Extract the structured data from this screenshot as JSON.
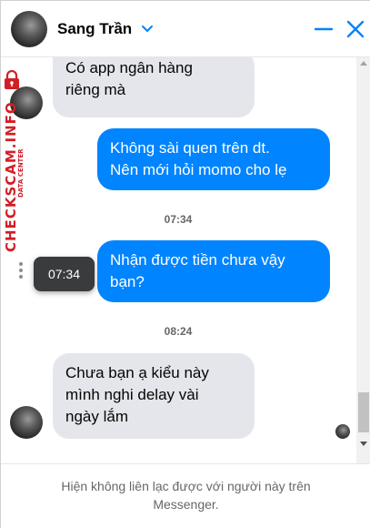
{
  "header": {
    "contact_name": "Sang Trần",
    "icons": {
      "dropdown": "chevron-down-icon",
      "minimize": "minimize-icon",
      "close": "close-icon"
    },
    "accent_color": "#0084ff"
  },
  "messages": [
    {
      "direction": "incoming",
      "lines": [
        "Có app ngân hàng",
        "riêng mà"
      ]
    },
    {
      "direction": "outgoing",
      "lines": [
        "Không sài quen trên dt.",
        "Nên mới hỏi momo cho lẹ"
      ]
    },
    {
      "direction": "outgoing",
      "lines": [
        "Nhận được tiền chưa vậy",
        "bạn?"
      ]
    },
    {
      "direction": "incoming",
      "lines": [
        "Chưa bạn ạ kiểu này",
        "mình nghi delay vài",
        "ngày lắm"
      ]
    }
  ],
  "timestamps": [
    "07:34",
    "08:24"
  ],
  "tooltip": {
    "text": "07:34"
  },
  "footer": {
    "notice": "Hiện không liên lạc được với người này trên Messenger."
  },
  "watermark": {
    "text": "CHECKSCAM.INFO",
    "subtext": "DATA CENTER",
    "color": "#d21f26"
  },
  "colors": {
    "outgoing_bubble": "#0084ff",
    "incoming_bubble": "#e4e6eb",
    "muted_text": "#65676b"
  }
}
